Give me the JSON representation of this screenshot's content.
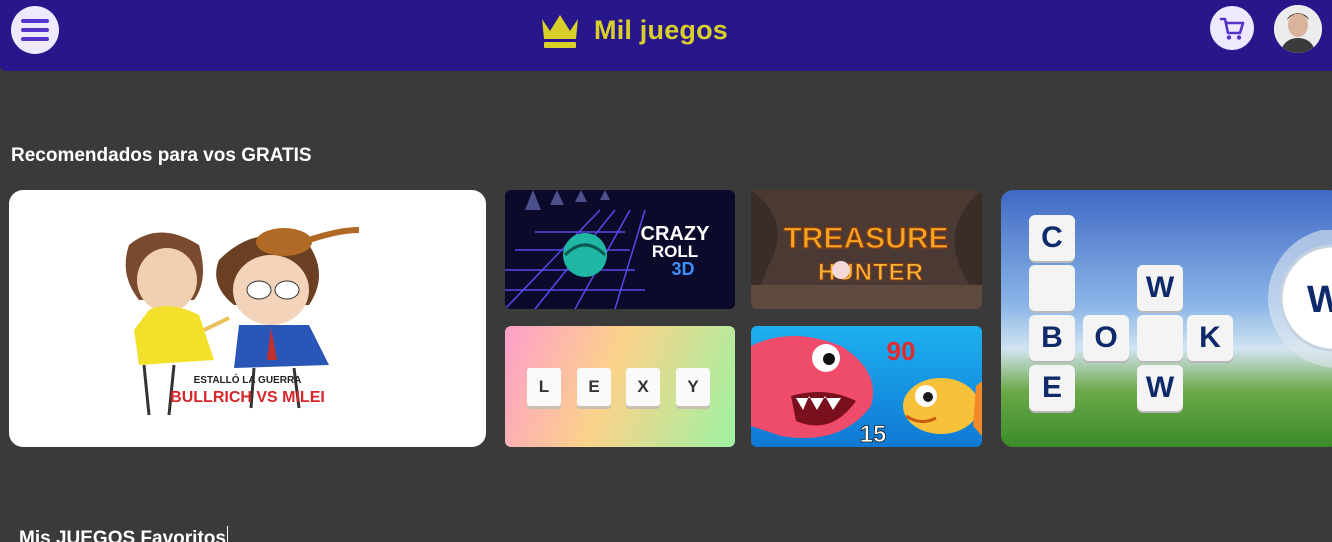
{
  "header": {
    "brand": "Mil juegos"
  },
  "sections": [
    {
      "title": "Recomendados para vos GRATIS"
    },
    {
      "title": "Mis JUEGOS Favoritos"
    }
  ],
  "games": {
    "featured": {
      "caption_top": "ESTALLÓ LA GUERRA",
      "caption_main": "BULLRICH VS MILEI"
    },
    "crazy_roll": {
      "line1": "CRAZY",
      "line2": "ROLL",
      "line3": "3D"
    },
    "treasure": {
      "line1": "TREASURE",
      "line2": "HUNTER"
    },
    "lexy": {
      "letters": [
        "L",
        "E",
        "X",
        "Y"
      ]
    },
    "shark": {
      "score_top": "90",
      "score_bottom": "15"
    },
    "words": {
      "tiles": [
        "C",
        "W",
        "B",
        "O",
        "K",
        "E",
        "W"
      ],
      "bubble": "W"
    }
  },
  "colors": {
    "header_bg": "#28178a",
    "brand": "#d8cf2a",
    "page_bg": "#3a3a3a"
  },
  "icons": [
    "menu-icon",
    "crown-icon",
    "cart-icon",
    "user-avatar"
  ]
}
